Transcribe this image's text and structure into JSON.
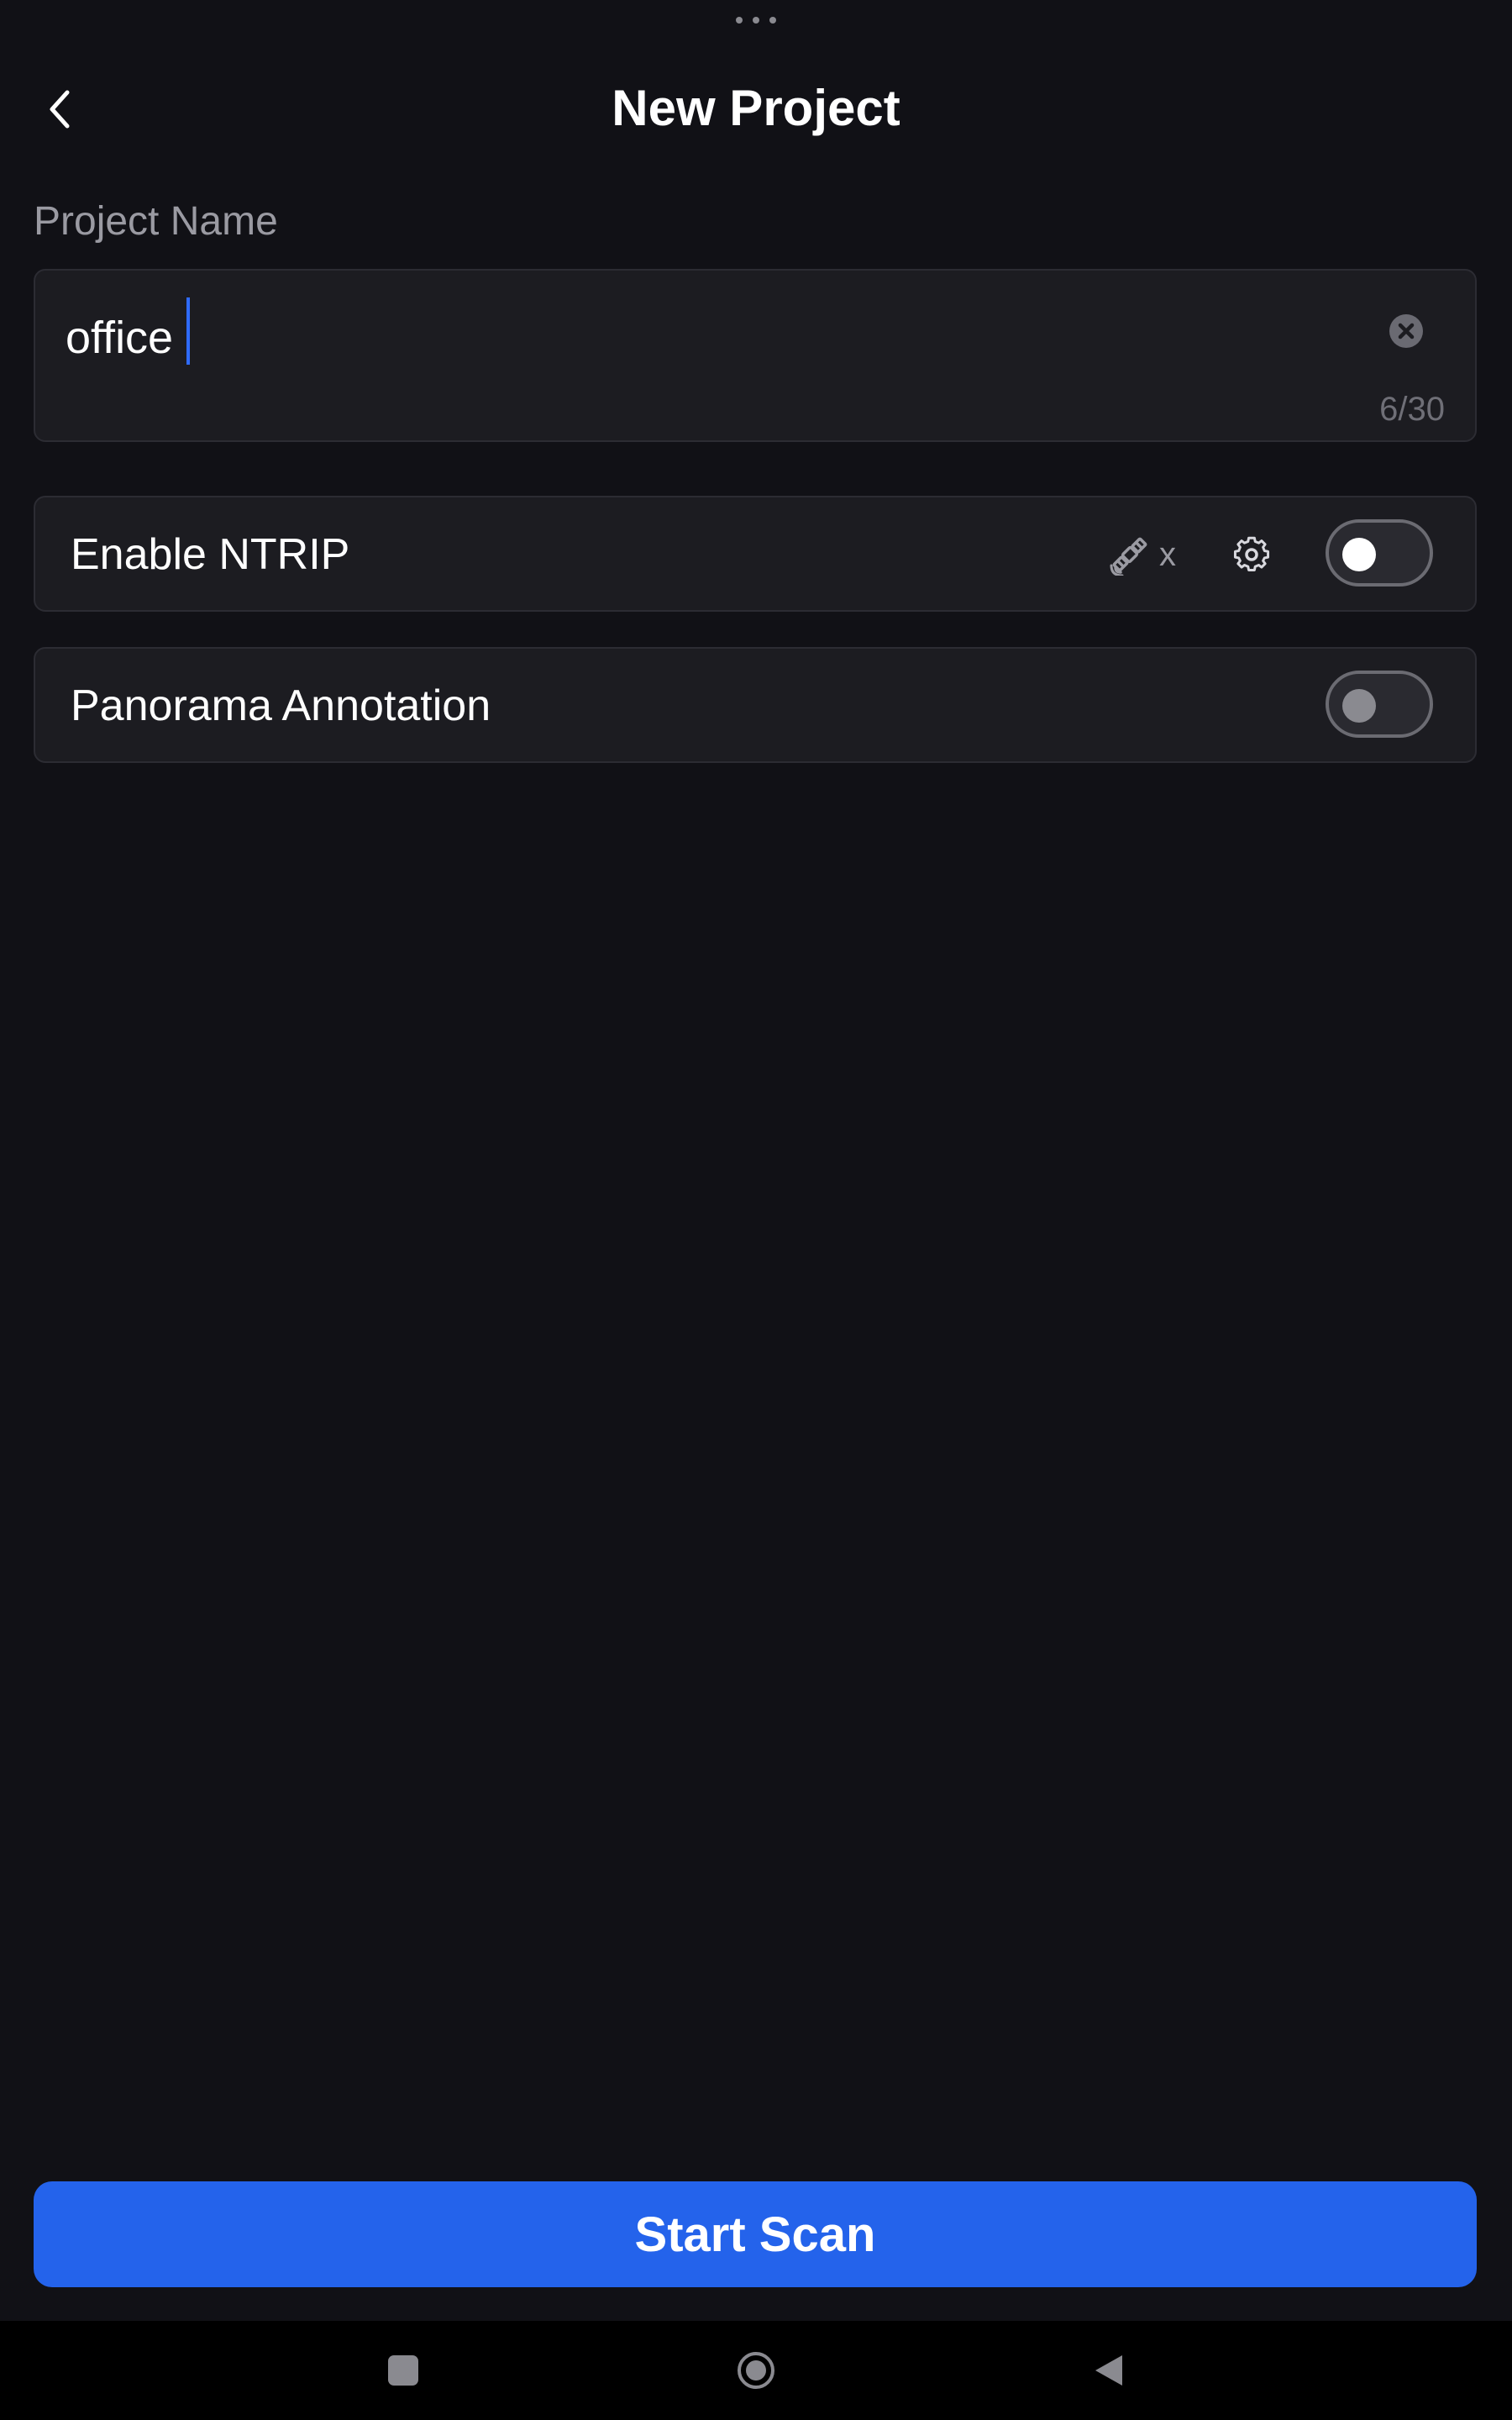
{
  "header": {
    "title": "New Project",
    "back_icon": "chevron-left-icon"
  },
  "project_name": {
    "label": "Project Name",
    "value": "office",
    "char_count": "6/30",
    "clear_icon": "clear-circle-icon"
  },
  "ntrip": {
    "label": "Enable NTRIP",
    "satellite_icon": "satellite-icon",
    "satellite_status": "x",
    "settings_icon": "gear-icon",
    "enabled": false
  },
  "panorama": {
    "label": "Panorama Annotation",
    "enabled": false
  },
  "start_button": {
    "label": "Start Scan"
  },
  "colors": {
    "background": "#111116",
    "card": "#1c1c21",
    "accent": "#2463eb",
    "muted_text": "#9a9aa2"
  },
  "system_nav": {
    "items": [
      "recents-icon",
      "home-icon",
      "back-triangle-icon"
    ]
  }
}
